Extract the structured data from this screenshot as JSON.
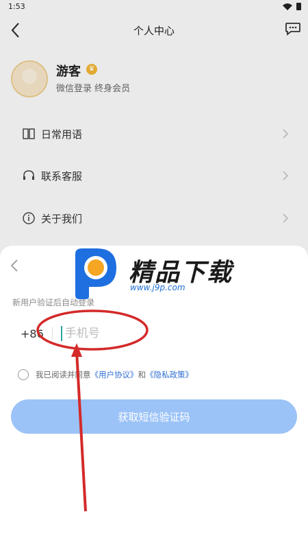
{
  "status_bar": {
    "time": "1:53"
  },
  "header": {
    "title": "个人中心"
  },
  "profile": {
    "name": "游客",
    "member_label": "微信登录 终身会员"
  },
  "menu": [
    {
      "label": "日常用语",
      "icon": "translate-icon"
    },
    {
      "label": "联系客服",
      "icon": "headset-icon"
    },
    {
      "label": "关于我们",
      "icon": "info-icon"
    }
  ],
  "login_sheet": {
    "subtitle": "新用户验证后自动登录",
    "country_code": "+86",
    "phone_placeholder": "手机号",
    "agreement": {
      "prefix": "我已阅读并同意",
      "user_agreement": "《用户协议》",
      "and": "和",
      "privacy_policy": "《隐私政策》"
    },
    "sms_button": "获取短信验证码"
  },
  "watermark": {
    "brand": "精品下载",
    "url": "www.j9p.com"
  },
  "colors": {
    "accent": "#9cc3f7",
    "link": "#2f6fd3",
    "annotation": "#d42a2a",
    "crown": "#f0b437"
  }
}
